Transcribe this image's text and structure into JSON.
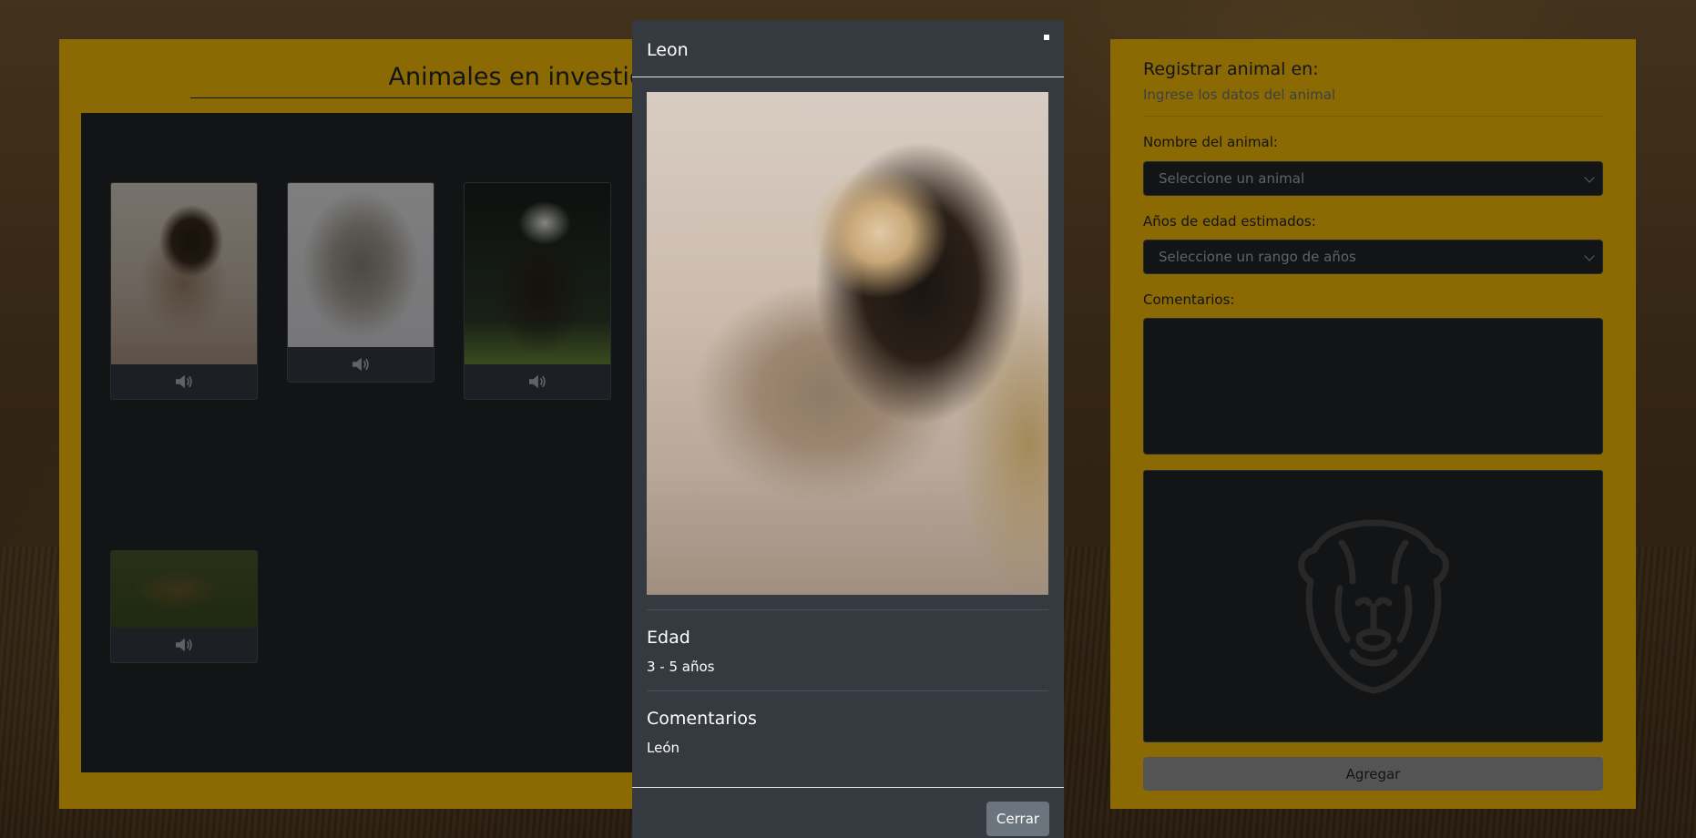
{
  "gallery": {
    "title": "Animales en investigación",
    "cards": [
      {
        "animal": "lion",
        "audio_icon": "speaker-icon"
      },
      {
        "animal": "wolf",
        "audio_icon": "speaker-icon"
      },
      {
        "animal": "eagle",
        "audio_icon": "speaker-icon"
      },
      {
        "animal": "snake",
        "audio_icon": "speaker-icon"
      }
    ]
  },
  "form": {
    "title": "Registrar animal en:",
    "subtitle": "Ingrese los datos del animal",
    "name_label": "Nombre del animal:",
    "name_select": "Seleccione un animal",
    "age_label": "Años de edad estimados:",
    "age_select": "Seleccione un rango de años",
    "comments_label": "Comentarios:",
    "comments_value": "",
    "preview_icon": "lion-outline-icon",
    "submit_label": "Agregar"
  },
  "modal": {
    "title": "Leon",
    "age_heading": "Edad",
    "age_value": "3 - 5 años",
    "comments_heading": "Comentarios",
    "comments_value": "León",
    "close_label": "Cerrar"
  },
  "colors": {
    "accent": "#ffc107",
    "dark": "#212529",
    "modal_bg": "#343a40",
    "secondary_button": "#6c757d"
  }
}
